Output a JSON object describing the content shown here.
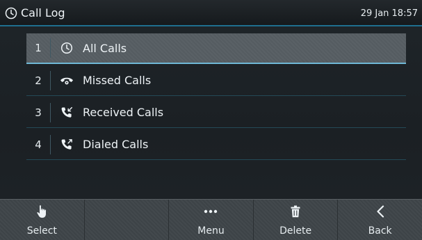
{
  "header": {
    "title": "Call Log",
    "title_icon": "clock-icon",
    "datetime": "29 Jan 18:57"
  },
  "menu": {
    "selected_index": 0,
    "items": [
      {
        "number": "1",
        "label": "All Calls",
        "icon": "clock-icon"
      },
      {
        "number": "2",
        "label": "Missed Calls",
        "icon": "missed-call-icon"
      },
      {
        "number": "3",
        "label": "Received Calls",
        "icon": "received-call-icon"
      },
      {
        "number": "4",
        "label": "Dialed Calls",
        "icon": "dialed-call-icon"
      }
    ]
  },
  "softkeys": [
    {
      "label": "Select",
      "icon": "hand-pointer-icon"
    },
    {
      "label": "",
      "icon": ""
    },
    {
      "label": "Menu",
      "icon": "more-dots-icon"
    },
    {
      "label": "Delete",
      "icon": "trash-icon"
    },
    {
      "label": "Back",
      "icon": "back-chevron-icon"
    }
  ],
  "colors": {
    "accent": "#1f6f8f",
    "selection_underline": "#6fb8d6",
    "background": "#1e2327",
    "text": "#eef3f6"
  }
}
